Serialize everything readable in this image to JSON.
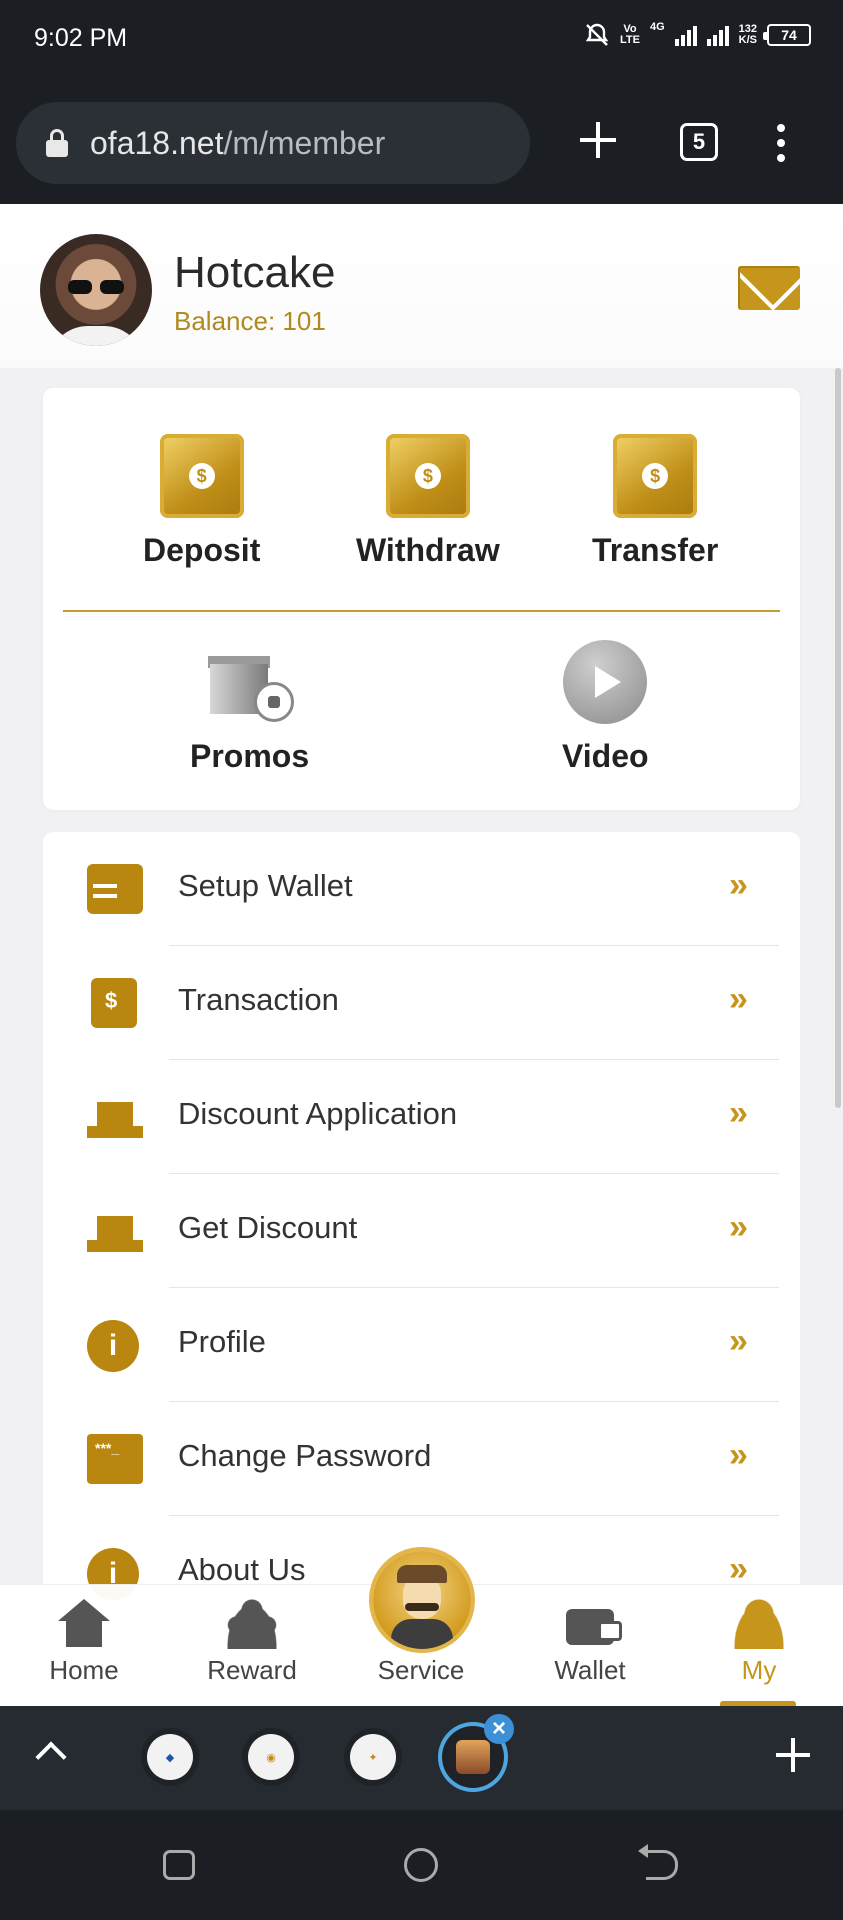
{
  "status_bar": {
    "time": "9:02 PM",
    "network_top": "Vo",
    "network_bottom": "LTE",
    "gen": "4G",
    "speed_value": "132",
    "speed_unit": "K/S",
    "battery": "74"
  },
  "browser": {
    "url_domain": "ofa18.net",
    "url_path": "/m/member",
    "tab_count": "5"
  },
  "profile": {
    "username": "Hotcake",
    "balance_text": "Balance: 101"
  },
  "actions": [
    {
      "label": "Deposit",
      "icon": "piggy-bank-icon"
    },
    {
      "label": "Withdraw",
      "icon": "hand-coin-icon"
    },
    {
      "label": "Transfer",
      "icon": "transfer-coin-icon"
    },
    {
      "label": "Promos",
      "icon": "gift-icon"
    },
    {
      "label": "Video",
      "icon": "play-icon"
    }
  ],
  "menu": [
    {
      "label": "Setup Wallet",
      "icon": "wallet-check-icon"
    },
    {
      "label": "Transaction",
      "icon": "receipt-icon"
    },
    {
      "label": "Discount Application",
      "icon": "gift-hand-icon"
    },
    {
      "label": "Get Discount",
      "icon": "gift-hand-icon"
    },
    {
      "label": "Profile",
      "icon": "info-icon"
    },
    {
      "label": "Change Password",
      "icon": "password-screen-icon"
    },
    {
      "label": "About Us",
      "icon": "about-icon"
    }
  ],
  "bottom_nav": [
    {
      "label": "Home",
      "icon": "home-icon"
    },
    {
      "label": "Reward",
      "icon": "reward-icon"
    },
    {
      "label": "Service",
      "icon": "service-avatar-icon"
    },
    {
      "label": "Wallet",
      "icon": "wallet-icon"
    },
    {
      "label": "My",
      "icon": "my-icon",
      "active": true
    }
  ],
  "colors": {
    "accent": "#c6951b",
    "status_bar": "#1b1f24",
    "page_bg": "#f1f1f3"
  }
}
